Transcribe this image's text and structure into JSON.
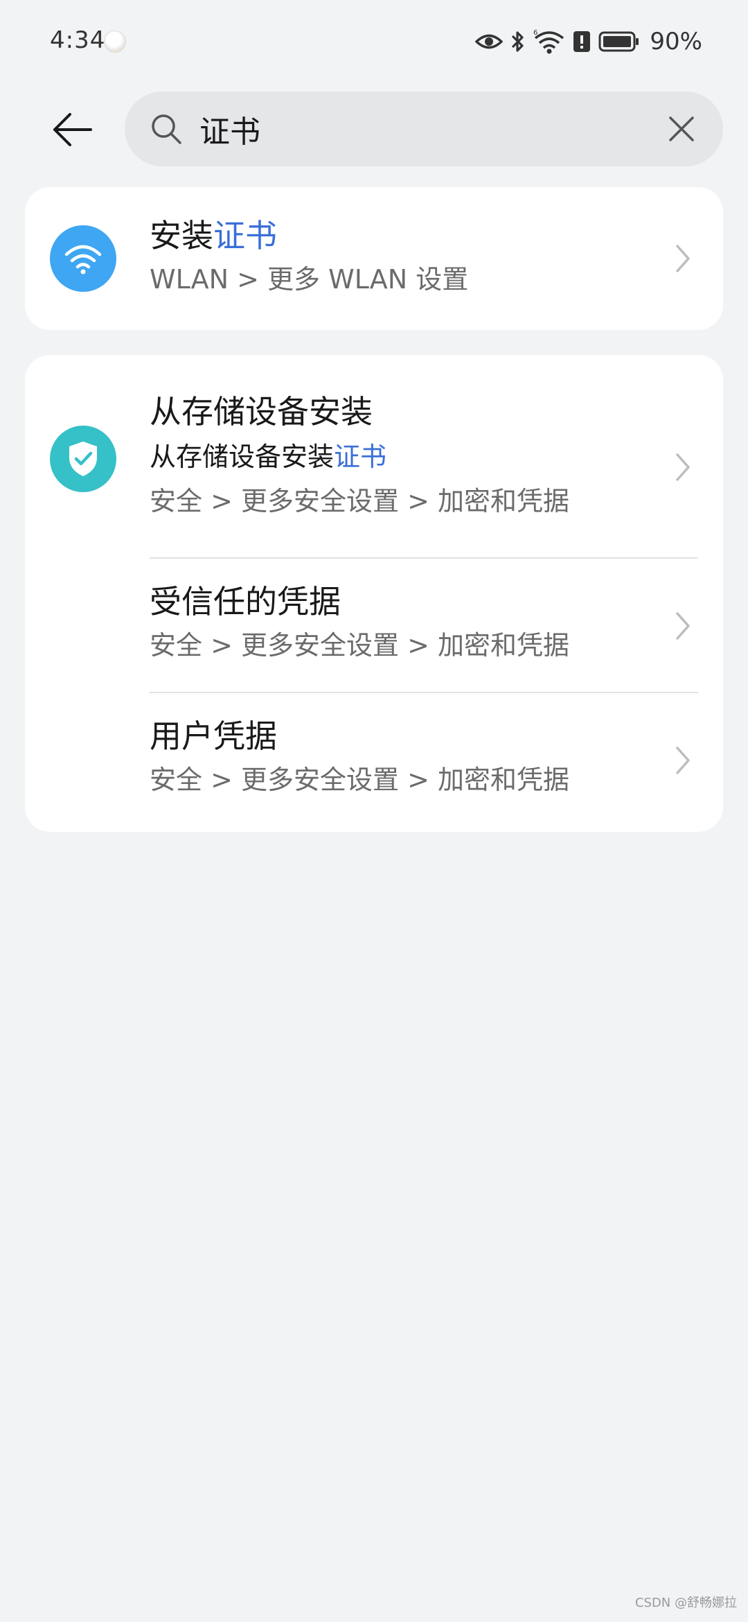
{
  "status_bar": {
    "time": "4:34",
    "battery": "90%",
    "network_label": "6",
    "icons": [
      "weather-icon",
      "eye-comfort-icon",
      "bluetooth-icon",
      "wifi-6-icon",
      "notification-alert-icon",
      "battery-icon"
    ]
  },
  "search": {
    "query": "证书",
    "icons": [
      "back-arrow-icon",
      "search-icon",
      "clear-icon"
    ]
  },
  "results": {
    "card1": {
      "icon": "wifi-icon",
      "title_plain": "安装",
      "title_highlight": "证书",
      "path": "WLAN > 更多 WLAN 设置"
    },
    "card2": {
      "icon": "shield-check-icon",
      "items": [
        {
          "title": "从存储设备安装",
          "subtitle_plain": "从存储设备安装",
          "subtitle_highlight": "证书",
          "path": "安全 > 更多安全设置 > 加密和凭据"
        },
        {
          "title": "受信任的凭据",
          "path": "安全 > 更多安全设置 > 加密和凭据"
        },
        {
          "title": "用户凭据",
          "path": "安全 > 更多安全设置 > 加密和凭据"
        }
      ]
    }
  },
  "colors": {
    "background": "#f1f3f5",
    "card": "#ffffff",
    "highlight": "#3b6fd8",
    "wifi_icon_bg": "#3ea6f2",
    "shield_icon_bg": "#36c0c8",
    "secondary_text": "#6b6b6b"
  },
  "watermark": "CSDN @舒畅娜拉"
}
